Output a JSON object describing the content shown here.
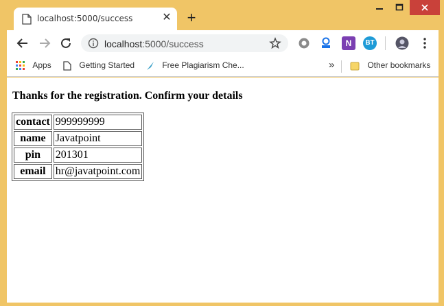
{
  "tab": {
    "title": "localhost:5000/success",
    "close": "✕",
    "new_tab": "+"
  },
  "window_controls": {
    "minimize": "—",
    "maximize": "☐",
    "close": "✕"
  },
  "address_bar": {
    "host": "localhost",
    "path": ":5000/success"
  },
  "extensions": [
    {
      "name": "settings-extension",
      "label": ""
    },
    {
      "name": "lens-extension",
      "label": ""
    },
    {
      "name": "onenote-extension",
      "label": "N"
    },
    {
      "name": "bt-extension",
      "label": "BT"
    }
  ],
  "bookmarks": {
    "apps": "Apps",
    "getting_started": "Getting Started",
    "plagiarism": "Free Plagiarism Che...",
    "overflow": "»",
    "other": "Other bookmarks"
  },
  "page": {
    "heading": "Thanks for the registration. Confirm your details",
    "rows": [
      {
        "key": "contact",
        "value": "999999999"
      },
      {
        "key": "name",
        "value": "Javatpoint"
      },
      {
        "key": "pin",
        "value": "201301"
      },
      {
        "key": "email",
        "value": "hr@javatpoint.com"
      }
    ]
  },
  "colors": {
    "frame": "#f0c566",
    "close_button": "#c9413a",
    "accent_blue": "#1a73e8"
  }
}
